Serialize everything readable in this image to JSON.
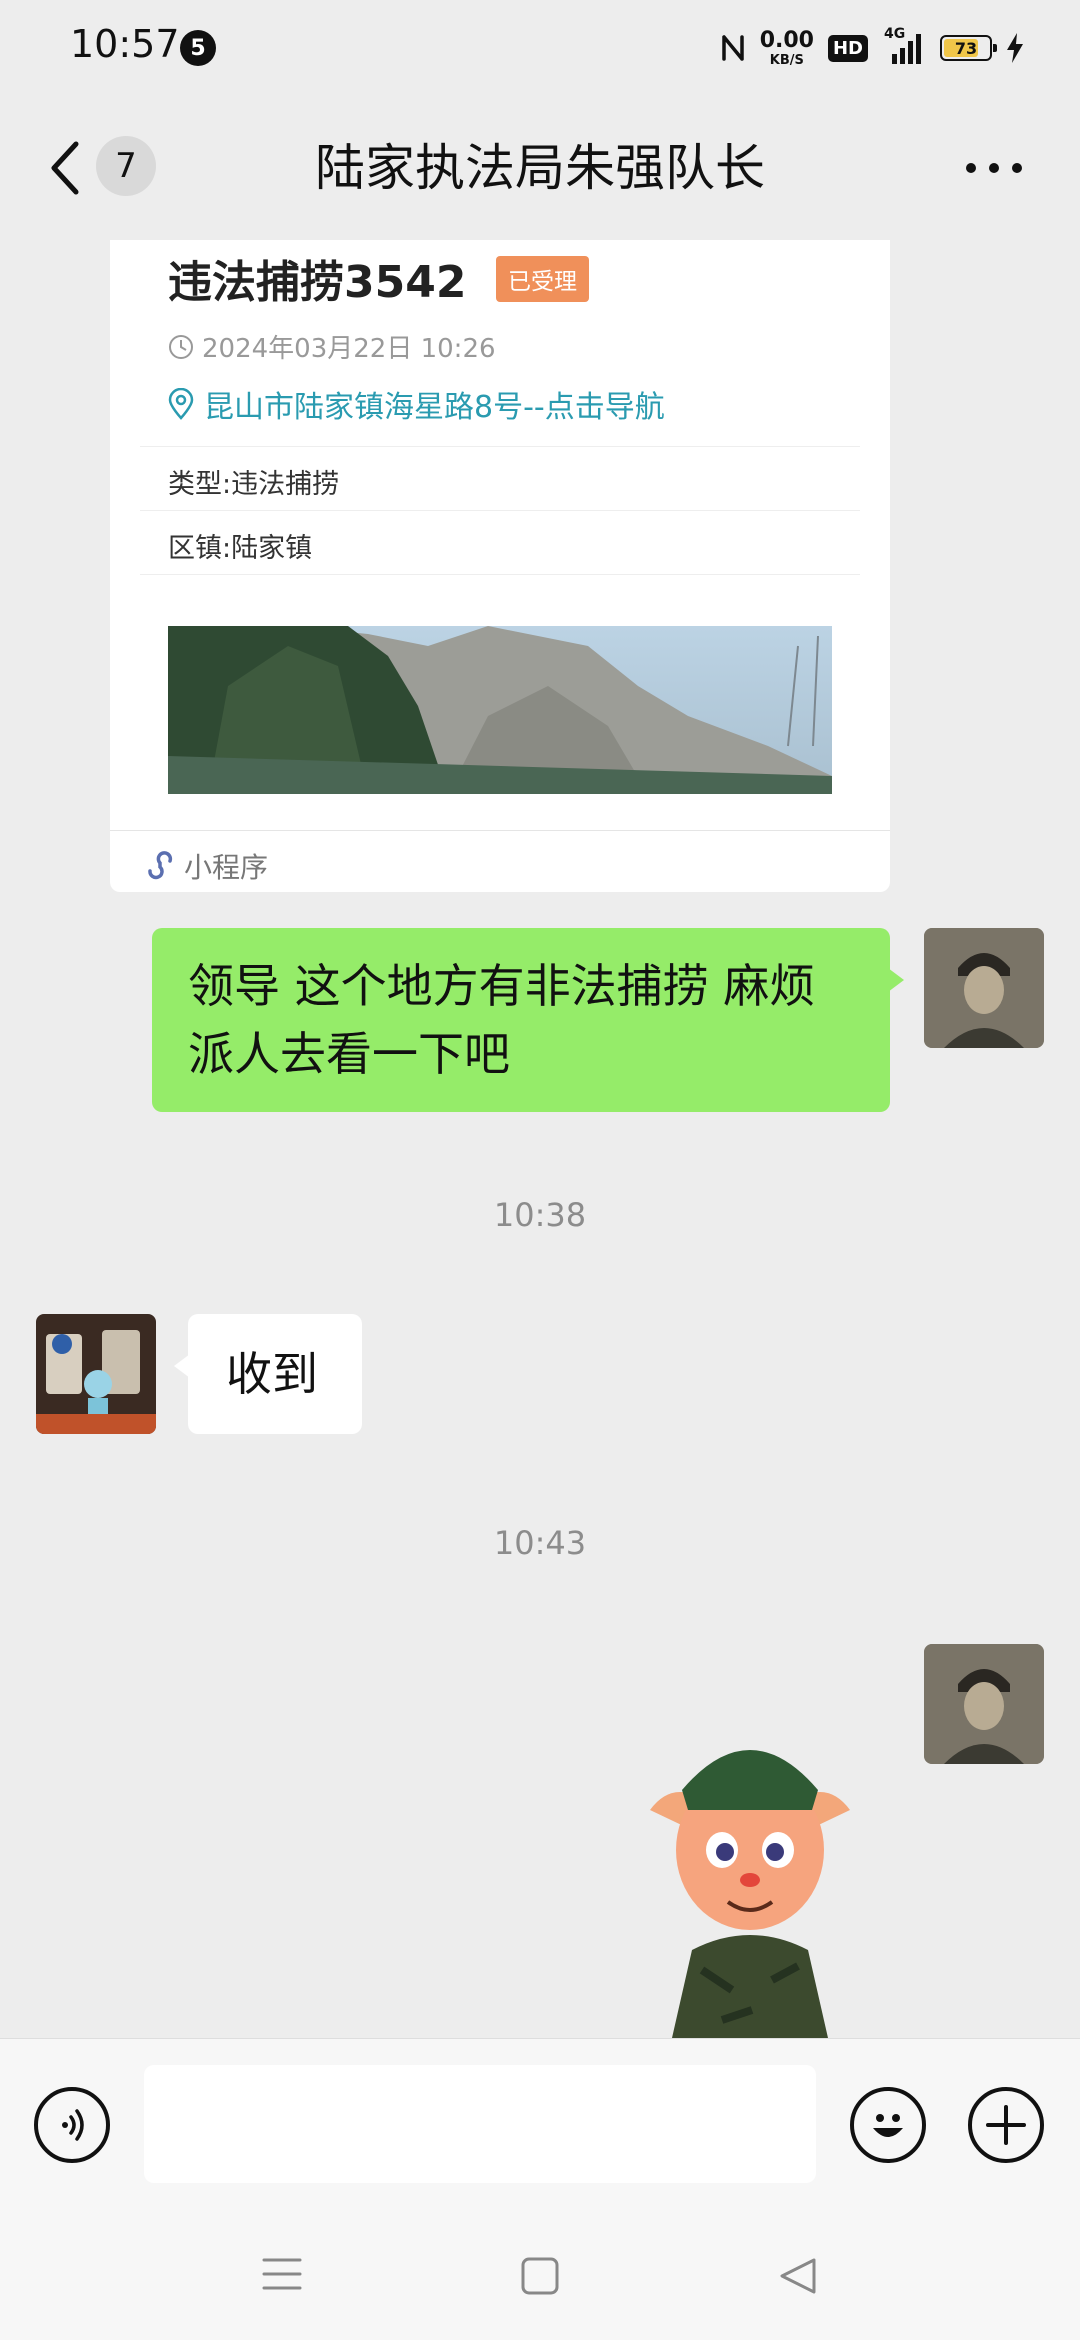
{
  "status_bar": {
    "time": "10:57",
    "notification_count": "5",
    "net_speed_value": "0.00",
    "net_speed_unit": "KB/S",
    "hd_label": "HD",
    "network_label": "4G",
    "battery_level": "73",
    "battery_color": "#f0c649"
  },
  "header": {
    "unread_count": "7",
    "title": "陆家执法局朱强队长"
  },
  "card": {
    "title": "违法捕捞3542",
    "status_badge": "已受理",
    "datetime": "2024年03月22日 10:26",
    "address": "昆山市陆家镇海星路8号--点击导航",
    "type_label": "类型:",
    "type_value": "违法捕捞",
    "town_label": "区镇:",
    "town_value": "陆家镇",
    "footer_label": "小程序",
    "status_color": "#f0905a",
    "address_color": "#2a9bb0"
  },
  "messages": [
    {
      "side": "right",
      "text": "领导 这个地方有非法捕捞 麻烦派人去看一下吧"
    },
    {
      "side": "left",
      "text": "收到"
    },
    {
      "side": "right",
      "type": "sticker"
    }
  ],
  "time_separators": [
    "10:38",
    "10:43"
  ],
  "icons": {
    "voice": "voice-icon",
    "emoji": "emoji-icon",
    "plus": "plus-icon"
  },
  "colors": {
    "sent_bubble": "#95ec69",
    "chat_background": "#ededed"
  }
}
